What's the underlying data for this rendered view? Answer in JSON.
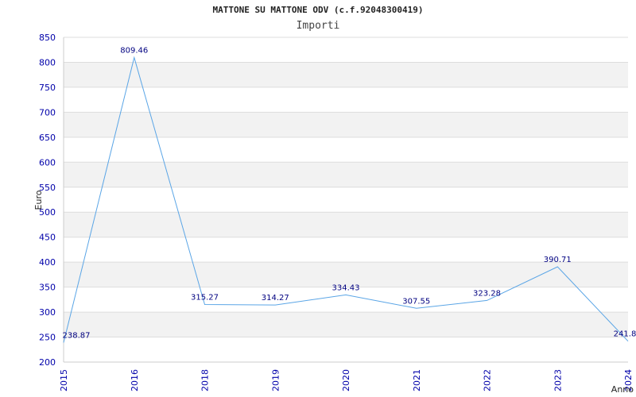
{
  "chart_data": {
    "type": "line",
    "title": "MATTONE SU MATTONE ODV (c.f.92048300419)",
    "subtitle": "Importi",
    "xlabel": "Anno",
    "ylabel": "Euro",
    "categories": [
      "2015",
      "2016",
      "2018",
      "2019",
      "2020",
      "2021",
      "2022",
      "2023",
      "2024"
    ],
    "series": [
      {
        "values": [
          238.87,
          809.46,
          315.27,
          314.27,
          334.43,
          307.55,
          323.28,
          390.71,
          241.8
        ],
        "labels": [
          "238.87",
          "809.46",
          "315.27",
          "314.27",
          "334.43",
          "307.55",
          "323.28",
          "390.71",
          "241.8"
        ]
      }
    ],
    "ylim": [
      200,
      850
    ],
    "yticks": [
      200,
      250,
      300,
      350,
      400,
      450,
      500,
      550,
      600,
      650,
      700,
      750,
      800,
      850
    ],
    "grid": "horizontal alternating bands",
    "line_color": "#5aa5e6",
    "band_color": "#f2f2f2"
  }
}
